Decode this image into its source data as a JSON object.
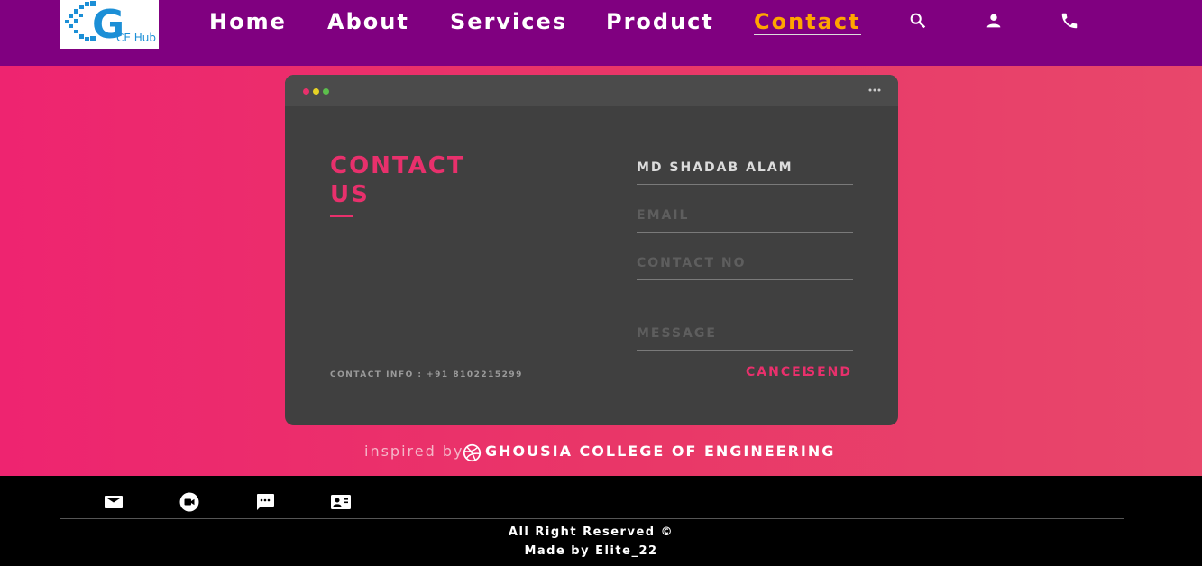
{
  "nav": {
    "logo_text": "CE Hub",
    "links": [
      "Home",
      "About",
      "Services",
      "Product",
      "Contact"
    ],
    "active": "Contact",
    "icons": [
      "search-icon",
      "person-icon",
      "phone-icon"
    ]
  },
  "card": {
    "window_dots_colors": [
      "#e8306c",
      "#e6d325",
      "#5cbf4c"
    ],
    "title_line1": "CONTACT",
    "title_line2": "US",
    "contact_info": "CONTACT INFO : +91 8102215299",
    "name_value": "MD SHADAB ALAM",
    "email_placeholder": "EMAIL",
    "contact_placeholder": "CONTACT NO",
    "message_placeholder": "MESSAGE",
    "cancel_label": "CANCEL",
    "send_label": "SEND"
  },
  "inspired": {
    "prefix": "inspired by",
    "college": "GHOUSIA COLLEGE OF ENGINEERING"
  },
  "footer": {
    "icons": [
      "email-icon",
      "video-call-icon",
      "chat-icon",
      "contact-card-icon"
    ],
    "rights": "All Right Reserved ©",
    "made_by": "Made by Elite_22"
  },
  "colors": {
    "nav_bg": "#800080",
    "accent": "#e8306c",
    "active_link": "#ffa500",
    "card_bg": "#404040"
  }
}
